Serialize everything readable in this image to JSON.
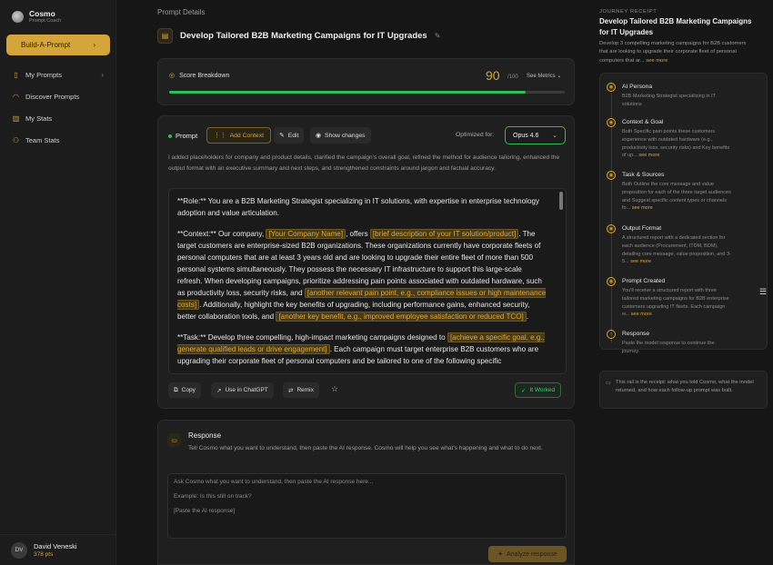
{
  "sidebar": {
    "brand": "Cosmo",
    "brand_sub": "Prompt Coach",
    "build_label": "Build-A-Prompt",
    "items": [
      {
        "label": "My Prompts"
      },
      {
        "label": "Discover Prompts"
      },
      {
        "label": "My Stats"
      },
      {
        "label": "Team Stats"
      }
    ],
    "user": {
      "initials": "DV",
      "name": "David Veneski",
      "points": "378 pts"
    }
  },
  "main": {
    "breadcrumb": "Prompt Details",
    "title": "Develop Tailored B2B Marketing Campaigns for IT Upgrades",
    "score": {
      "label": "Score Breakdown",
      "value": "90",
      "max": "/100",
      "metrics": "See Metrics",
      "fraction": 0.9
    },
    "prompt": {
      "tab": "Prompt",
      "add_context": "Add Context",
      "edit": "Edit",
      "show_changes": "Show changes",
      "optimized_label": "Optimized for:",
      "model": "Opus 4.6",
      "summary": "I added placeholders for company and product details, clarified the campaign's overall goal, refined the method for audience tailoring, enhanced the output format with an executive summary and next steps, and strengthened constraints around jargon and factual accuracy.",
      "role_text": "**Role:** You are a B2B Marketing Strategist specializing in IT solutions, with expertise in enterprise technology adoption and value articulation.",
      "ctx_1": "**Context:** Our company,",
      "ph_company": "[Your Company Name]",
      "ctx_2": ", offers",
      "ph_solution": "[brief description of your IT solution/product]",
      "ctx_3": ". The target customers are enterprise-sized B2B organizations. These organizations currently have corporate fleets of personal computers that are at least 3 years old and are looking to upgrade their entire fleet of more than 500 personal systems simultaneously. They possess the necessary IT infrastructure to support this large-scale refresh. When developing campaigns, prioritize addressing pain points associated with outdated hardware, such as productivity loss, security risks, and",
      "ph_pain": "[another relevant pain point, e.g., compliance issues or high maintenance costs]",
      "ctx_4": ". Additionally, highlight the key benefits of upgrading, including performance gains, enhanced security, better collaboration tools, and",
      "ph_benefit": "[another key benefit, e.g., improved employee satisfaction or reduced TCO]",
      "ctx_5": ".",
      "task_1": "**Task:** Develop three compelling, high-impact marketing campaigns designed to",
      "ph_goal": "[achieve a specific goal, e.g., generate qualified leads or drive engagement]",
      "task_2": ". Each campaign must target enterprise B2B customers who are upgrading their corporate fleet of personal computers and be tailored to one of the following specific",
      "copy": "Copy",
      "use_chatgpt": "Use in ChatGPT",
      "remix": "Remix",
      "worked": "It Worked"
    },
    "response": {
      "title": "Response",
      "desc": "Tell Cosmo what you want to understand, then paste the AI response. Cosmo will help you see what's happening and what to do next.",
      "placeholder": "Ask Cosmo what you want to understand, then paste the AI response here...\n\nExample: Is this still on track?\n\n[Paste the AI response]",
      "analyze": "Analyze response"
    }
  },
  "rail": {
    "tag": "JOURNEY RECEIPT",
    "title": "Develop Tailored B2B Marketing Campaigns for IT Upgrades",
    "desc": "Develop 3 compelling marketing campaigns for B2B customers that are looking to upgrade their corporate fleet of personal computers that ar...",
    "see_more": "see more",
    "steps": [
      {
        "name": "AI Persona",
        "desc": "B2B Marketing Strategist specializing in IT solutions",
        "more": ""
      },
      {
        "name": "Context & Goal",
        "desc": "Both Specific pain points these customers experience with outdated hardware (e.g., productivity loss, security risks) and Key benefits of up...",
        "more": "see more"
      },
      {
        "name": "Task & Sources",
        "desc": "Both Outline the core message and value proposition for each of the three target audiences and Suggest specific content types or channels fo...",
        "more": "see more"
      },
      {
        "name": "Output Format",
        "desc": "A structured report with a dedicated section for each audience (Procurement, ITDM, BDM), detailing core message, value proposition, and 3-5...",
        "more": "see more"
      },
      {
        "name": "Prompt Created",
        "desc": "You'll receive a structured report with three tailored marketing campaigns for B2B enterprise customers upgrading IT fleets. Each campaign w...",
        "more": "see more"
      },
      {
        "name": "Response",
        "desc": "Paste the model response to continue the journey.",
        "more": ""
      }
    ],
    "note": "This rail is the receipt: what you told Cosmo, what the model returned, and how each follow-up prompt was built."
  },
  "colors": {
    "accent": "#d4a53a",
    "success": "#2fbf5a",
    "background": "#161616"
  }
}
